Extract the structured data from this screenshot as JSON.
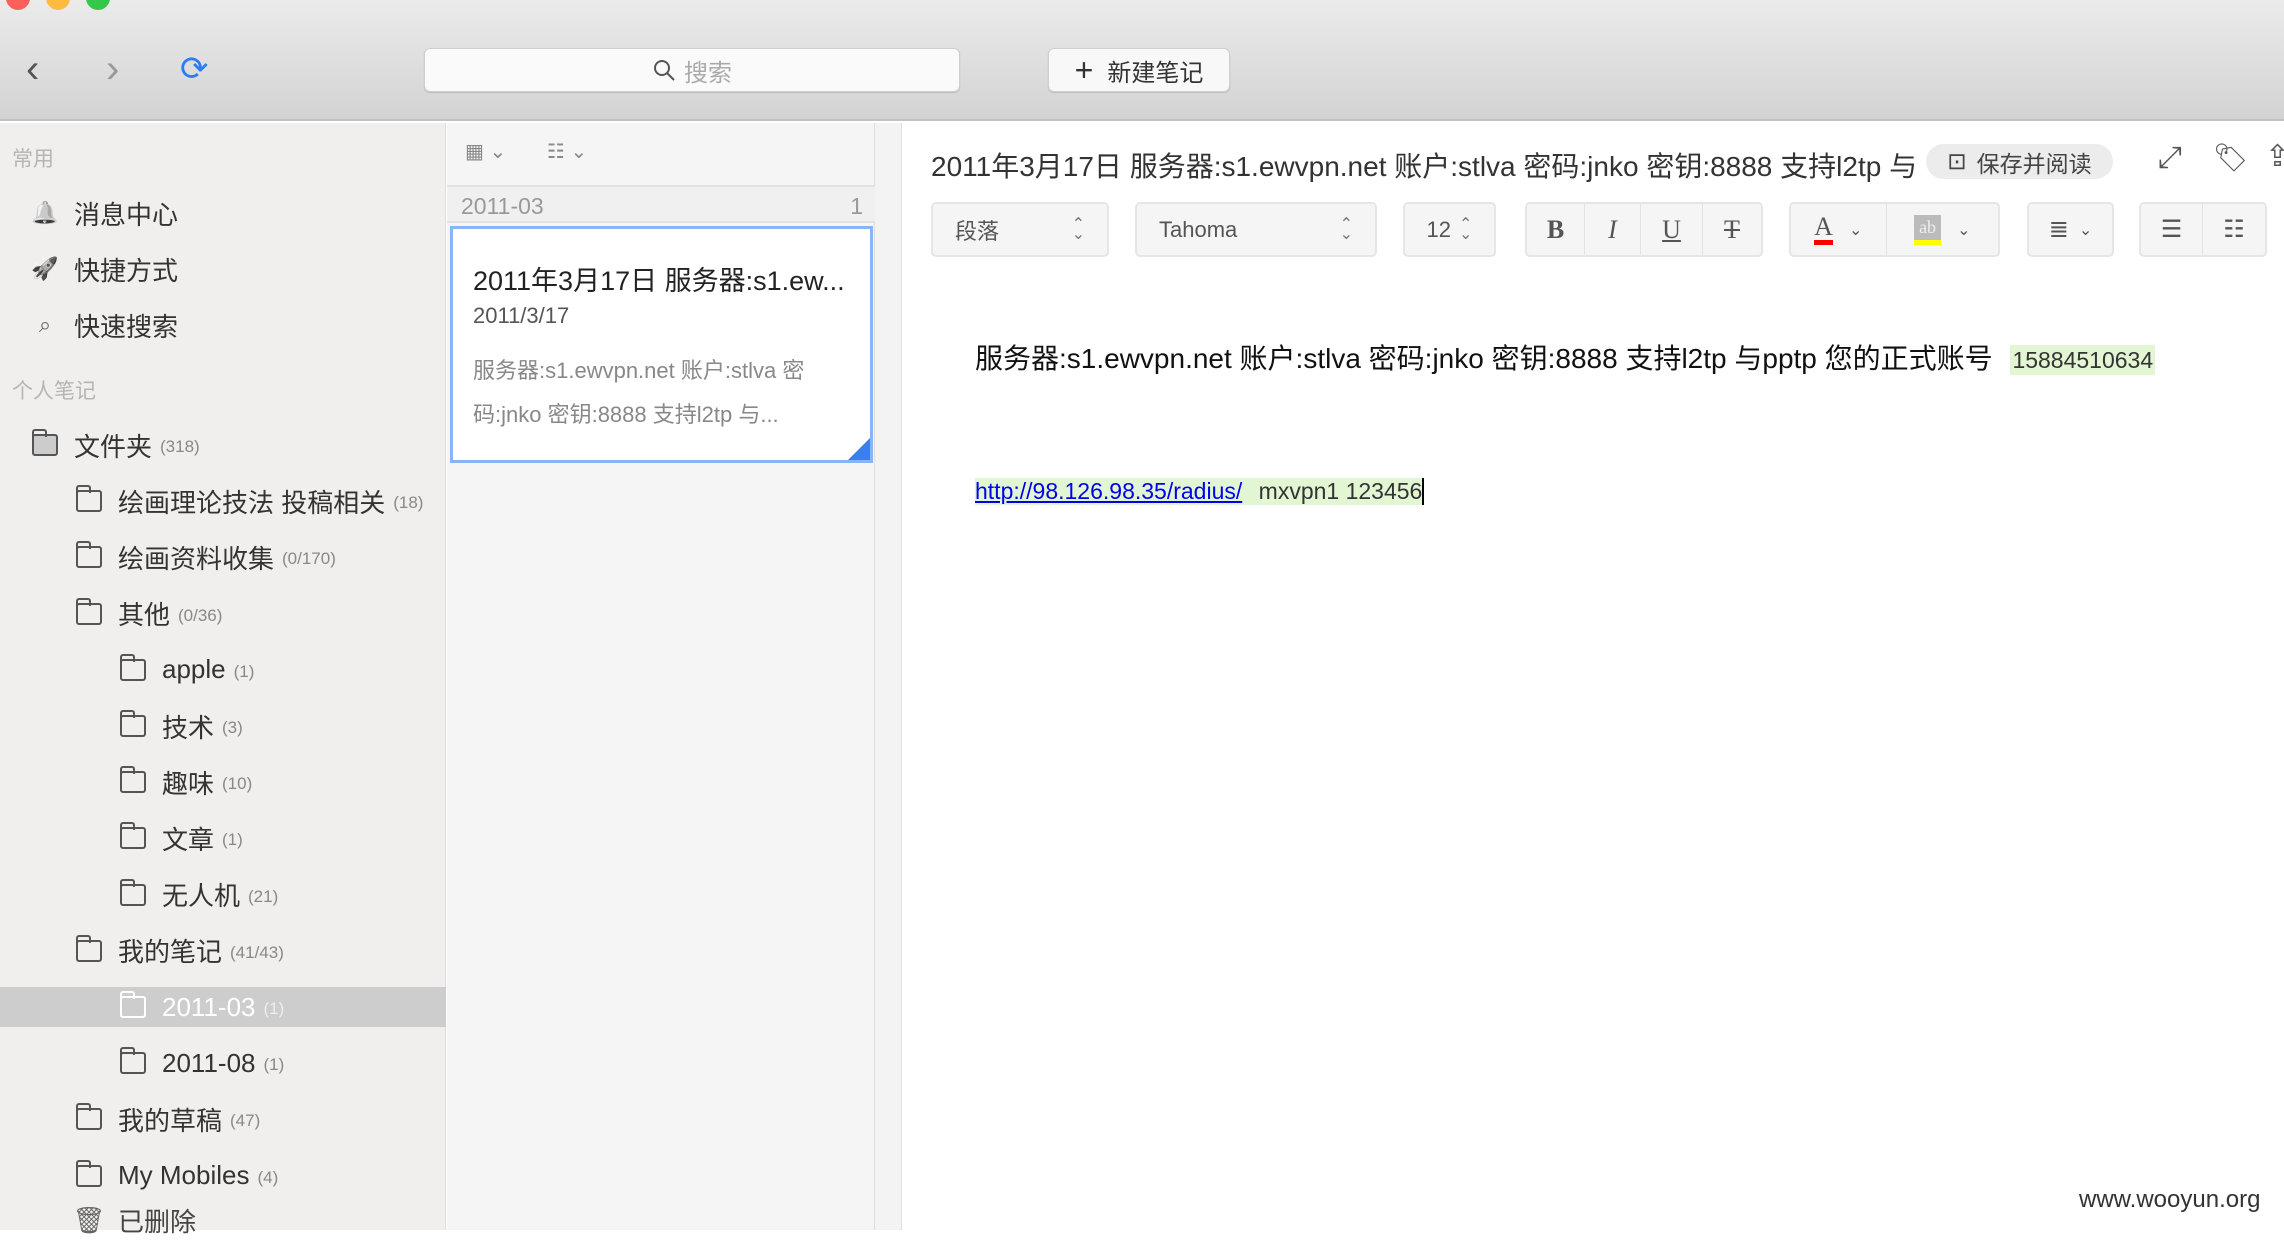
{
  "toolbar": {
    "search_placeholder": "搜索",
    "new_note": "新建笔记",
    "back": "‹",
    "forward": "›",
    "refresh": "⟳"
  },
  "sidebar": {
    "section_common": "常用",
    "common": [
      {
        "label": "消息中心",
        "icon": "bell-icon"
      },
      {
        "label": "快捷方式",
        "icon": "rocket-icon"
      },
      {
        "label": "快速搜索",
        "icon": "search-icon"
      }
    ],
    "section_personal": "个人笔记",
    "folders": [
      {
        "label": "文件夹",
        "count": "(318)",
        "level": 0
      },
      {
        "label": "绘画理论技法 投稿相关",
        "count": "(18)",
        "level": 1
      },
      {
        "label": "绘画资料收集",
        "count": "(0/170)",
        "level": 1
      },
      {
        "label": "其他",
        "count": "(0/36)",
        "level": 1
      },
      {
        "label": "apple",
        "count": "(1)",
        "level": 2
      },
      {
        "label": "技术",
        "count": "(3)",
        "level": 2
      },
      {
        "label": "趣味",
        "count": "(10)",
        "level": 2
      },
      {
        "label": "文章",
        "count": "(1)",
        "level": 2
      },
      {
        "label": "无人机",
        "count": "(21)",
        "level": 2
      },
      {
        "label": "我的笔记",
        "count": "(41/43)",
        "level": 1
      },
      {
        "label": "2011-03",
        "count": "(1)",
        "level": 2,
        "selected": true
      },
      {
        "label": "2011-08",
        "count": "(1)",
        "level": 2
      },
      {
        "label": "我的草稿",
        "count": "(47)",
        "level": 1
      },
      {
        "label": "My Mobiles",
        "count": "(4)",
        "level": 1
      }
    ],
    "trash": "已删除"
  },
  "notelist": {
    "group": "2011-03",
    "group_count": "1",
    "card": {
      "title": "2011年3月17日 服务器:s1.ew...",
      "date": "2011/3/17",
      "snippet1": "服务器:s1.ewvpn.net 账户:stlva 密",
      "snippet2": "码:jnko 密钥:8888 支持l2tp 与..."
    }
  },
  "editor": {
    "title": "2011年3月17日 服务器:s1.ewvpn.net 账户:stlva 密码:jnko 密钥:8888 支持l2tp 与",
    "save_read": "保存并阅读",
    "format": {
      "paragraph": "段落",
      "font": "Tahoma",
      "size": "12",
      "bold": "B",
      "italic": "I",
      "underline": "U",
      "strike": "T",
      "font_color": "A",
      "highlight": "ab"
    },
    "line1": "服务器:s1.ewvpn.net 账户:stlva 密码:jnko 密钥:8888 支持l2tp 与pptp 您的正式账号",
    "line1_highlight": "15884510634",
    "link": "http://98.126.98.35/radius/",
    "line2_rest": "mxvpn1 123456",
    "colors": {
      "font_color": "#ff0000",
      "highlight": "#ffff00",
      "text_bg": "#e3f6d4",
      "link": "#0000ee"
    }
  },
  "watermark": "www.wooyun.org"
}
